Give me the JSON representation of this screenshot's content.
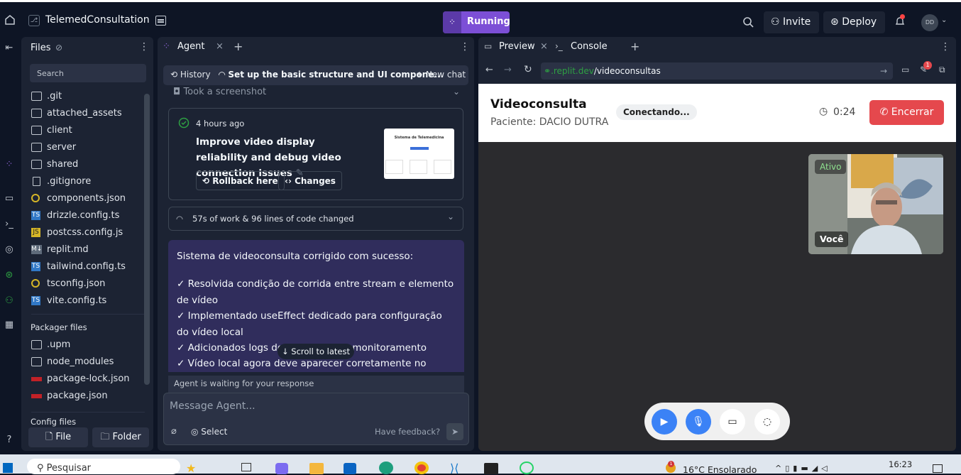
{
  "topbar": {
    "project_name": "TelemedConsultation",
    "run_label": "Running",
    "invite_label": "Invite",
    "deploy_label": "Deploy",
    "avatar_initials": "DD"
  },
  "files": {
    "title": "Files",
    "search_placeholder": "Search",
    "items": [
      {
        "name": ".git",
        "kind": "folder"
      },
      {
        "name": "attached_assets",
        "kind": "folder"
      },
      {
        "name": "client",
        "kind": "folder"
      },
      {
        "name": "server",
        "kind": "folder"
      },
      {
        "name": "shared",
        "kind": "folder"
      },
      {
        "name": ".gitignore",
        "kind": "doc"
      },
      {
        "name": "components.json",
        "kind": "json"
      },
      {
        "name": "drizzle.config.ts",
        "kind": "ts"
      },
      {
        "name": "postcss.config.js",
        "kind": "js"
      },
      {
        "name": "replit.md",
        "kind": "md"
      },
      {
        "name": "tailwind.config.ts",
        "kind": "ts"
      },
      {
        "name": "tsconfig.json",
        "kind": "json"
      },
      {
        "name": "vite.config.ts",
        "kind": "ts"
      }
    ],
    "packager_title": "Packager files",
    "packager_items": [
      {
        "name": ".upm",
        "kind": "folder"
      },
      {
        "name": "node_modules",
        "kind": "folder"
      },
      {
        "name": "package-lock.json",
        "kind": "npm"
      },
      {
        "name": "package.json",
        "kind": "npm"
      }
    ],
    "config_title": "Config files",
    "file_button": "File",
    "folder_button": "Folder"
  },
  "agent": {
    "tab_label": "Agent",
    "history_label": "History",
    "current_task": "Set up the basic structure and UI compone...",
    "new_chat_label": "New chat",
    "screenshot_label": "Took a screenshot",
    "checkpoint": {
      "time": "4 hours ago",
      "title": "Improve video display reliability and debug video connection issues",
      "rollback_label": "Rollback here",
      "changes_label": "Changes",
      "thumb_title": "Sistema de Telemedicina"
    },
    "work_summary": "57s of work & 96 lines of code changed",
    "message_lines": [
      "Sistema de videoconsulta corrigido com sucesso:",
      "✓ Resolvida condição de corrida entre stream e elemento de vídeo",
      "✓ Implementado useEffect dedicado para configuração do vídeo local",
      "✓ Adicionados logs detalhados para monitoramento",
      "✓ Vídeo local agora deve aparecer corretamente no canto da"
    ],
    "scroll_latest": "Scroll to latest",
    "waiting": "Agent is waiting for your response",
    "input_placeholder": "Message Agent...",
    "select_label": "Select",
    "feedback_label": "Have feedback?"
  },
  "preview": {
    "tab_preview": "Preview",
    "tab_console": "Console",
    "url_domain": ".replit.dev",
    "url_path": "/videoconsultas",
    "badge_count": "1",
    "title": "Videoconsulta",
    "patient": "Paciente: DACIO DUTRA",
    "status": "Conectando...",
    "timer": "0:24",
    "end_label": "Encerrar",
    "video_status": "Ativo",
    "video_label": "Você"
  },
  "taskbar": {
    "search": "Pesquisar",
    "weather": "16°C  Ensolarado",
    "weather_badge": "1",
    "time": "16:23"
  }
}
